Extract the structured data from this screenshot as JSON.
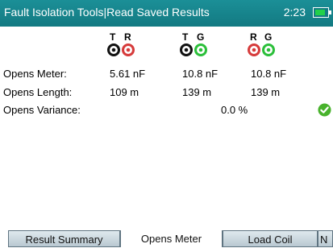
{
  "header": {
    "title": "Fault Isolation Tools|Read Saved Results",
    "time": "2:23"
  },
  "pairs": [
    {
      "left": "T",
      "right": "R",
      "right_color": "#d63b3b"
    },
    {
      "left": "T",
      "right": "G",
      "right_color": "#2bbf3a"
    },
    {
      "left": "R",
      "right": "G",
      "left_color": "#d63b3b",
      "right_color": "#2bbf3a"
    }
  ],
  "rows": {
    "opens_meter": {
      "label": "Opens Meter:",
      "values": [
        "5.61 nF",
        "10.8 nF",
        "10.8 nF"
      ]
    },
    "opens_length": {
      "label": "Opens Length:",
      "values": [
        "109 m",
        "139 m",
        "139 m"
      ]
    },
    "opens_variance": {
      "label": "Opens Variance:",
      "value": "0.0 %"
    }
  },
  "tabs": {
    "result_summary": "Result Summary",
    "opens_meter": "Opens Meter",
    "load_coil": "Load Coil",
    "partial": "N"
  },
  "icons": {
    "battery": "battery-icon",
    "check": "check-circle-icon"
  },
  "colors": {
    "title_bar": "#137a82",
    "status_ok": "#48b22c"
  }
}
